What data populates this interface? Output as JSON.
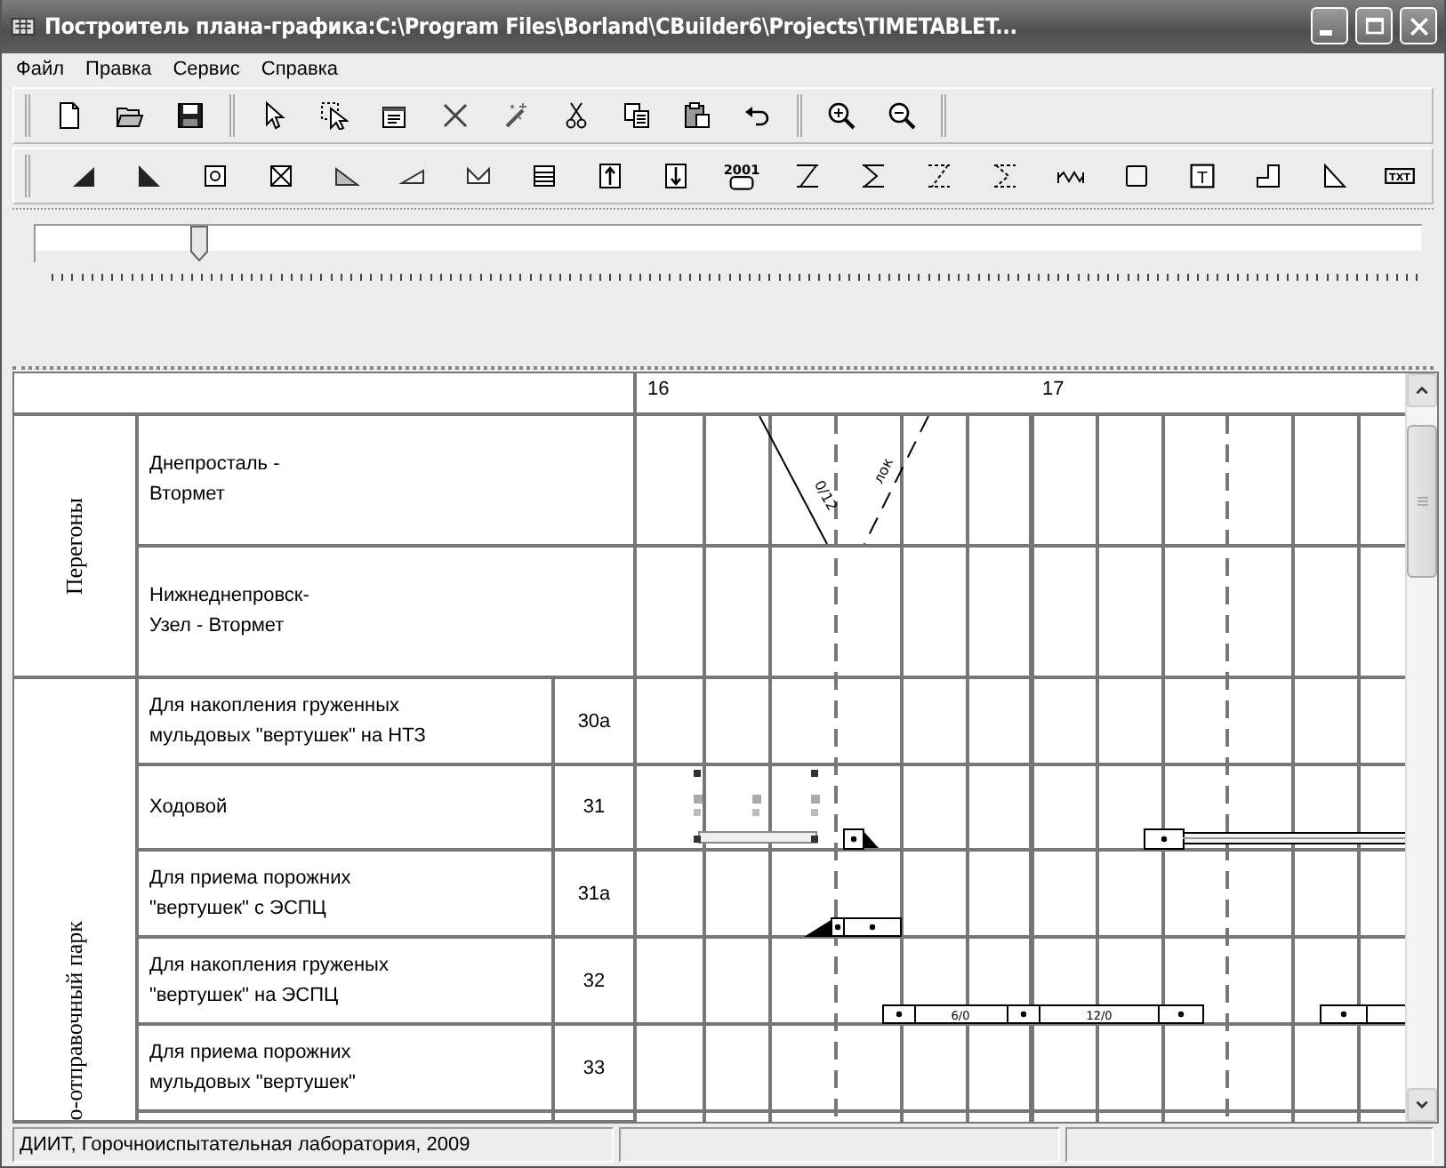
{
  "window": {
    "title": "Построитель плана-графика:C:\\Program Files\\Borland\\CBuilder6\\Projects\\TIMETABLET..."
  },
  "menu": [
    {
      "label": "Файл"
    },
    {
      "label": "Правка"
    },
    {
      "label": "Сервис"
    },
    {
      "label": "Справка"
    }
  ],
  "toolbar_1": [
    [
      {
        "kind": "new"
      },
      {
        "kind": "open"
      },
      {
        "kind": "save"
      }
    ],
    [
      {
        "kind": "pointer"
      },
      {
        "kind": "pointer-select"
      },
      {
        "kind": "properties"
      },
      {
        "kind": "delete"
      },
      {
        "kind": "wand"
      },
      {
        "kind": "cut"
      },
      {
        "kind": "copy"
      },
      {
        "kind": "paste"
      },
      {
        "kind": "undo"
      }
    ],
    [
      {
        "kind": "zoom-in"
      },
      {
        "kind": "zoom-out"
      }
    ]
  ],
  "toolbar_2": [
    {
      "kind": "wedge-left"
    },
    {
      "kind": "wedge-right"
    },
    {
      "kind": "ring-box"
    },
    {
      "kind": "cross-box"
    },
    {
      "kind": "grey-wedge"
    },
    {
      "kind": "flat-wedge"
    },
    {
      "kind": "notch"
    },
    {
      "kind": "lines-box"
    },
    {
      "kind": "up-box"
    },
    {
      "kind": "down-box"
    },
    {
      "kind": "year-block",
      "label": "2001"
    },
    {
      "kind": "zed"
    },
    {
      "kind": "sigma"
    },
    {
      "kind": "dash-zed"
    },
    {
      "kind": "dash-sigma"
    },
    {
      "kind": "zigzag"
    },
    {
      "kind": "square"
    },
    {
      "kind": "letter-box",
      "label": "T"
    },
    {
      "kind": "step"
    },
    {
      "kind": "triangle"
    },
    {
      "kind": "tag-block",
      "label": "TXT"
    }
  ],
  "slider": {
    "level": 0.118
  },
  "timeline": {
    "hours": [
      {
        "label": "16"
      },
      {
        "label": "17"
      }
    ]
  },
  "groups": [
    {
      "label": "Перегоны",
      "kind": "line",
      "rows": [
        {
          "name": "Днепросталь - Втормет",
          "labels": [
            "0/12",
            "лок"
          ]
        },
        {
          "name": "Нижнеднепровск-Узел - Втормет"
        }
      ]
    },
    {
      "label": "о-отправочный парк",
      "kind": "track",
      "rows": [
        {
          "name": "Для накопления груженных мульдовых \"вертушек\" на НТЗ",
          "number": "30а"
        },
        {
          "name": "Ходовой",
          "number": "31"
        },
        {
          "name": "Для приема порожних \"вертушек\" с ЭСПЦ",
          "number": "31а"
        },
        {
          "name": "Для накопления груженых \"вертушек\" на ЭСПЦ",
          "number": "32",
          "labels": [
            "6/0",
            "12/0"
          ]
        },
        {
          "name": "Для приема порожних мульдовых \"вертушек\"",
          "number": "33"
        }
      ]
    }
  ],
  "status_bar": [
    {
      "text": "ДИИТ, Горочноиспытательная лаборатория, 2009"
    }
  ]
}
